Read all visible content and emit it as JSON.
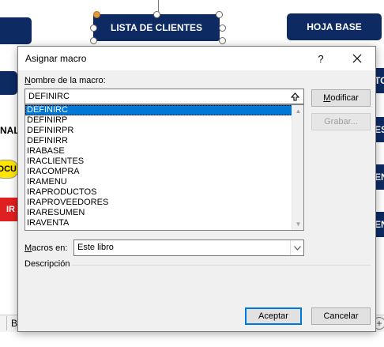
{
  "background": {
    "shape_lista": "LISTA DE CLIENTES",
    "shape_hoja": "HOJA BASE",
    "right_shape_1": "TO",
    "right_shape_2": "ES",
    "right_shape_3": "EN",
    "right_shape_4": "EN",
    "left_text": "NAL",
    "yellow_text": "OCU",
    "red_text": "IR",
    "status_letter": "B",
    "add_sheet": "+"
  },
  "dialog": {
    "title": "Asignar macro",
    "help": "?",
    "name_label_prefix": "N",
    "name_label_rest": "ombre de la macro:",
    "name_value": "DEFINIRC",
    "macros": [
      "DEFINIRC",
      "DEFINIRP",
      "DEFINIRPR",
      "DEFINIRR",
      "IRABASE",
      "IRACLIENTES",
      "IRACOMPRA",
      "IRAMENU",
      "IRAPRODUCTOS",
      "IRAPROVEEDORES",
      "IRARESUMEN",
      "IRAVENTA"
    ],
    "selected_index": 0,
    "modify_prefix": "M",
    "modify_rest": "odificar",
    "record_label": "Grabar...",
    "macros_in_prefix": "M",
    "macros_in_rest": "acros en:",
    "macros_in_value": "Este libro",
    "description_label": "Descripción",
    "accept_label": "Aceptar",
    "cancel_label": "Cancelar"
  },
  "colors": {
    "navy": "#0d2a62",
    "selection": "#0078d7",
    "yellow": "#ffe600",
    "red": "#e02020"
  }
}
